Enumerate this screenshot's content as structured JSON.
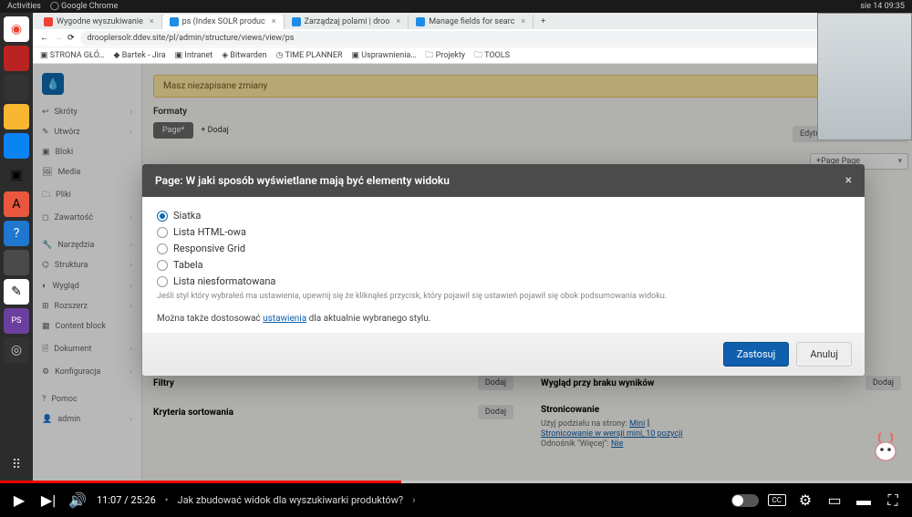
{
  "ubuntu_bar": {
    "activities": "Activities",
    "app": "Google Chrome",
    "timestamp": "sie 14  09:35"
  },
  "chrome": {
    "tabs": [
      {
        "label": "Wygodne wyszukiwanie",
        "active": false,
        "color": "#ea4335"
      },
      {
        "label": "ps (Index SOLR produc",
        "active": true,
        "color": "#1f8ce6"
      },
      {
        "label": "Zarządzaj polami | droo",
        "active": false,
        "color": "#1f8ce6"
      },
      {
        "label": "Manage fields for searc",
        "active": false,
        "color": "#1f8ce6"
      }
    ],
    "url": "drooplersolr.ddev.site/pl/admin/structure/views/view/ps",
    "bookmarks": [
      "STRONA GŁÓ…",
      "Bartek - Jira",
      "Intranet",
      "Bitwarden",
      "TIME PLANNER",
      "Usprawnienia…",
      "Projekty",
      "TOOLS"
    ]
  },
  "admin_sidebar": {
    "groups": [
      {
        "items": [
          {
            "icon": "↩",
            "label": "Skróty",
            "expand": true
          },
          {
            "icon": "✎",
            "label": "Utwórz",
            "expand": true
          },
          {
            "icon": "▣",
            "label": "Bloki"
          },
          {
            "icon": "🖼",
            "label": "Media"
          },
          {
            "icon": "🗀",
            "label": "Pliki"
          },
          {
            "icon": "◻",
            "label": "Zawartość",
            "expand": true
          }
        ]
      },
      {
        "header": "",
        "items": [
          {
            "icon": "🔧",
            "label": "Narzędzia",
            "expand": true
          },
          {
            "icon": "⌬",
            "label": "Struktura",
            "expand": true
          },
          {
            "icon": "◐",
            "label": "Wygląd",
            "expand": true
          },
          {
            "icon": "⊞",
            "label": "Rozszerz",
            "expand": true
          },
          {
            "icon": "▦",
            "label": "Content block"
          },
          {
            "icon": "🗎",
            "label": "Dokument",
            "expand": true
          },
          {
            "icon": "⚙",
            "label": "Konfiguracja",
            "expand": true
          }
        ]
      },
      {
        "items": [
          {
            "icon": "?",
            "label": "Pomoc"
          },
          {
            "icon": "👤",
            "label": "admin",
            "expand": true
          }
        ]
      }
    ]
  },
  "page": {
    "warn": "Masz niezapisane zmiany",
    "formaty_title": "Formaty",
    "page_chip": "Page*",
    "add": "+ Dodaj",
    "edit_name": "Edytuj nazwę/opis widoku",
    "select_page": "+Page Page",
    "filtry": "Filtry",
    "filtry_btn": "Dodaj",
    "kryteria": "Kryteria sortowania",
    "kryteria_btn": "Dodaj",
    "wyg": "Wygląd przy braku wyników",
    "wyg_btn": "Dodaj",
    "stron": "Stronicowanie",
    "stron_l1_a": "Użyj podziału na strony:",
    "stron_l1_b": "Mini",
    "stron_l2": "Stronicowanie w wersji mini, 10 pozycji",
    "stron_l3_a": "Odnośnik \"Więcej\":",
    "stron_l3_b": "Nie"
  },
  "modal": {
    "title": "Page: W jaki sposób wyświetlane mają być elementy widoku",
    "options": [
      "Siatka",
      "Lista HTML-owa",
      "Responsive Grid",
      "Tabela",
      "Lista niesformatowana"
    ],
    "selected": "Siatka",
    "hint": "Jeśli styl który wybrałeś ma ustawienia, upewnij się że kliknąłeś przycisk, który pojawił się ustawień pojawił się obok podsumowania widoku.",
    "para_pre": "Można także dostosować ",
    "para_link": "ustawienia",
    "para_post": " dla aktualnie wybranego stylu.",
    "apply": "Zastosuj",
    "cancel": "Anuluj"
  },
  "video": {
    "time": "11:07 / 25:26",
    "title": "Jak zbudować widok dla wyszukiwarki produktów?"
  }
}
